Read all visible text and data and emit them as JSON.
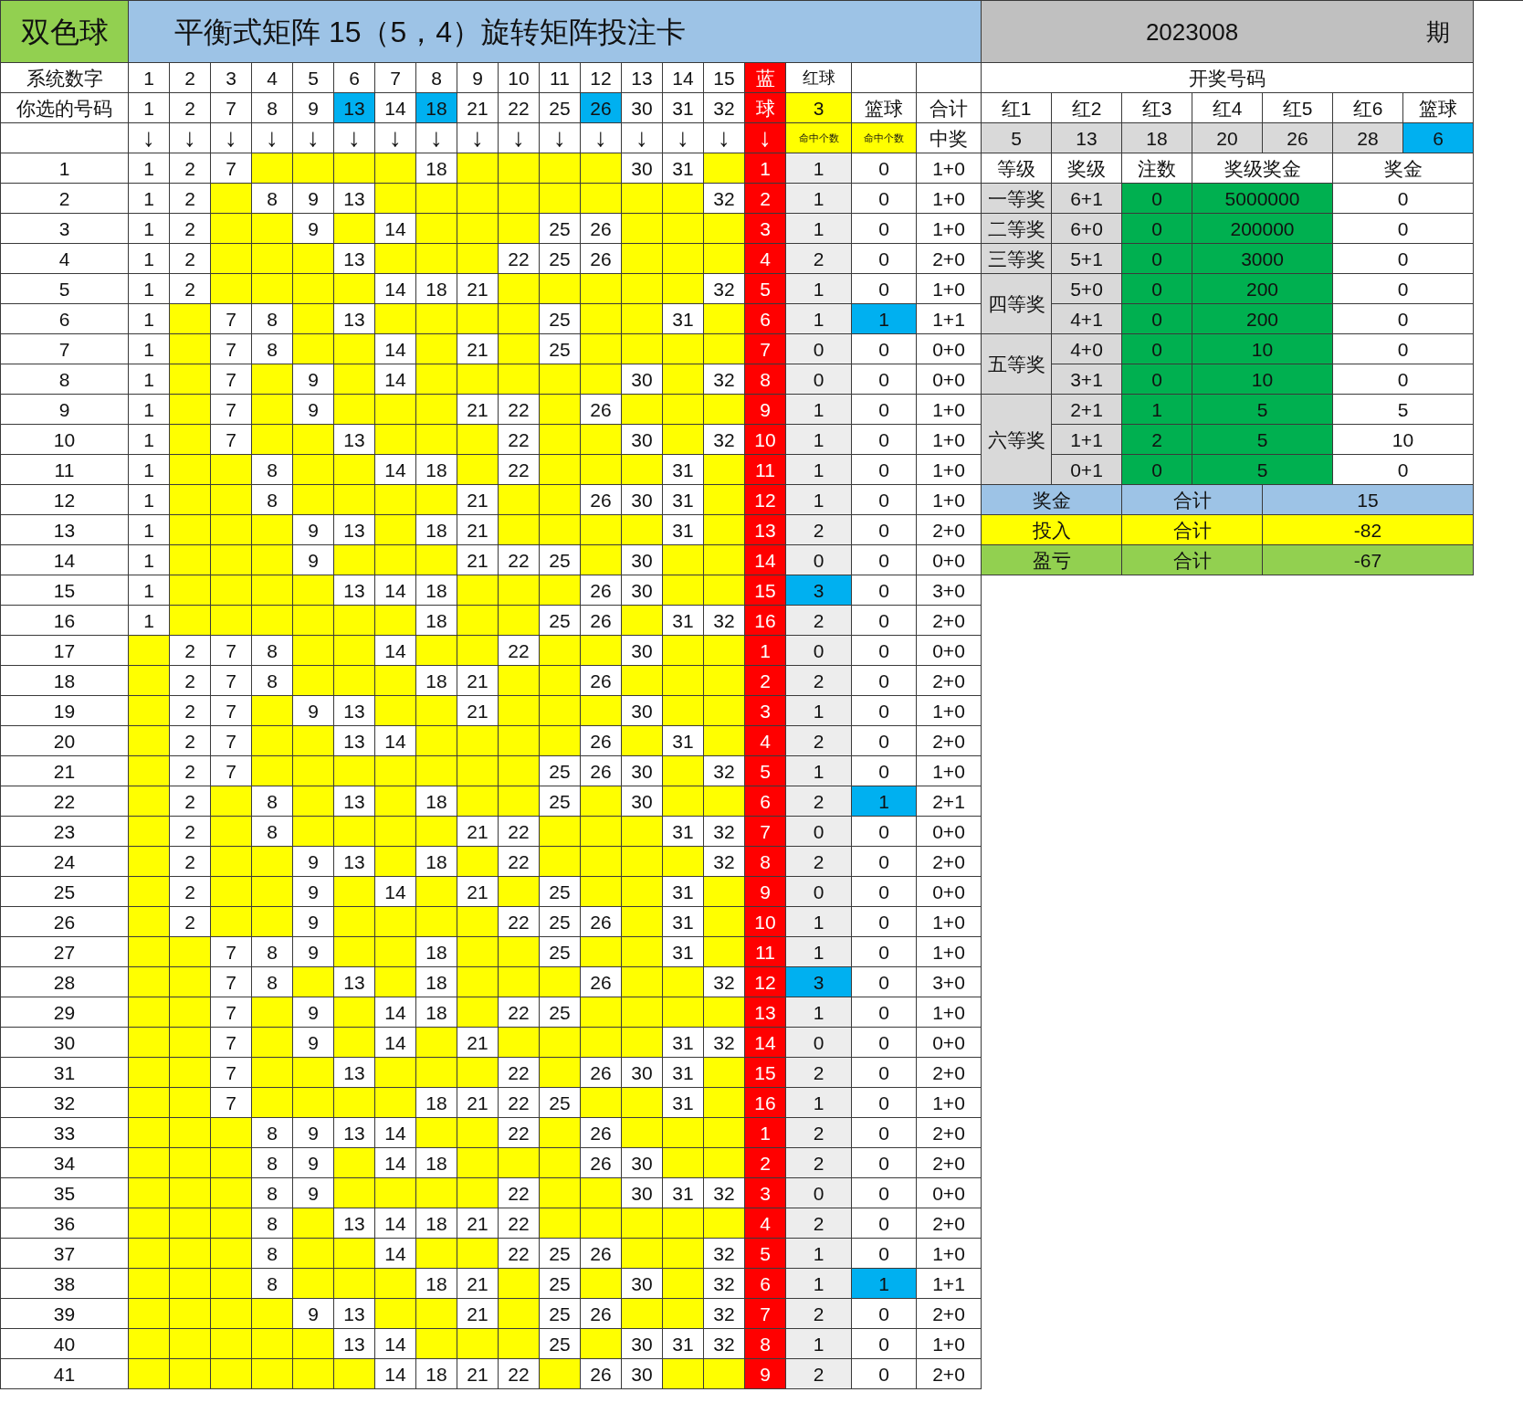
{
  "header": {
    "logo": "双色球",
    "title": "平衡式矩阵 15（5，4）旋转矩阵投注卡",
    "issue": "2023008",
    "issue_suffix": "期"
  },
  "system_row": {
    "label": "系统数字",
    "numbers": [
      "1",
      "2",
      "3",
      "4",
      "5",
      "6",
      "7",
      "8",
      "9",
      "10",
      "11",
      "12",
      "13",
      "14",
      "15"
    ],
    "blue_label": "蓝",
    "red_label": "红球"
  },
  "pick_row": {
    "label": "你选的号码",
    "numbers": [
      {
        "value": "1",
        "highlighted": false
      },
      {
        "value": "2",
        "highlighted": false
      },
      {
        "value": "7",
        "highlighted": false
      },
      {
        "value": "8",
        "highlighted": false
      },
      {
        "value": "9",
        "highlighted": false
      },
      {
        "value": "13",
        "highlighted": true
      },
      {
        "value": "14",
        "highlighted": false
      },
      {
        "value": "18",
        "highlighted": true
      },
      {
        "value": "21",
        "highlighted": false
      },
      {
        "value": "22",
        "highlighted": false
      },
      {
        "value": "25",
        "highlighted": false
      },
      {
        "value": "26",
        "highlighted": true
      },
      {
        "value": "30",
        "highlighted": false
      },
      {
        "value": "31",
        "highlighted": false
      },
      {
        "value": "32",
        "highlighted": false
      }
    ],
    "blue_label": "球",
    "red_hits": "3",
    "blue_ball_label": "篮球",
    "total_label": "合计"
  },
  "arrow_row": {
    "arrows": [
      "↓",
      "↓",
      "↓",
      "↓",
      "↓",
      "↓",
      "↓",
      "↓",
      "↓",
      "↓",
      "↓",
      "↓",
      "↓",
      "↓",
      "↓",
      "↓"
    ],
    "red_hits_label": "命中个数",
    "blue_hits_label": "命中个数",
    "prize_label": "中奖"
  },
  "rows": [
    {
      "no": "1",
      "cells": [
        "1",
        "2",
        "7",
        null,
        null,
        null,
        null,
        "18",
        null,
        null,
        null,
        null,
        "30",
        "31",
        null
      ],
      "blue": "1",
      "red_hits": "1",
      "blue_hits": "0",
      "total": "1+0",
      "red_hits_highlighted": false,
      "blue_hits_highlighted": false
    },
    {
      "no": "2",
      "cells": [
        "1",
        "2",
        null,
        "8",
        "9",
        "13",
        null,
        null,
        null,
        null,
        null,
        null,
        null,
        null,
        "32"
      ],
      "blue": "2",
      "red_hits": "1",
      "blue_hits": "0",
      "total": "1+0",
      "red_hits_highlighted": false,
      "blue_hits_highlighted": false
    },
    {
      "no": "3",
      "cells": [
        "1",
        "2",
        null,
        null,
        "9",
        null,
        "14",
        null,
        null,
        null,
        "25",
        "26",
        null,
        null,
        null
      ],
      "blue": "3",
      "red_hits": "1",
      "blue_hits": "0",
      "total": "1+0",
      "red_hits_highlighted": false,
      "blue_hits_highlighted": false
    },
    {
      "no": "4",
      "cells": [
        "1",
        "2",
        null,
        null,
        null,
        "13",
        null,
        null,
        null,
        "22",
        "25",
        "26",
        null,
        null,
        null
      ],
      "blue": "4",
      "red_hits": "2",
      "blue_hits": "0",
      "total": "2+0",
      "red_hits_highlighted": false,
      "blue_hits_highlighted": false
    },
    {
      "no": "5",
      "cells": [
        "1",
        "2",
        null,
        null,
        null,
        null,
        "14",
        "18",
        "21",
        null,
        null,
        null,
        null,
        null,
        "32"
      ],
      "blue": "5",
      "red_hits": "1",
      "blue_hits": "0",
      "total": "1+0",
      "red_hits_highlighted": false,
      "blue_hits_highlighted": false
    },
    {
      "no": "6",
      "cells": [
        "1",
        null,
        "7",
        "8",
        null,
        "13",
        null,
        null,
        null,
        null,
        "25",
        null,
        null,
        "31",
        null
      ],
      "blue": "6",
      "red_hits": "1",
      "blue_hits": "1",
      "total": "1+1",
      "red_hits_highlighted": false,
      "blue_hits_highlighted": true
    },
    {
      "no": "7",
      "cells": [
        "1",
        null,
        "7",
        "8",
        null,
        null,
        "14",
        null,
        "21",
        null,
        "25",
        null,
        null,
        null,
        null
      ],
      "blue": "7",
      "red_hits": "0",
      "blue_hits": "0",
      "total": "0+0",
      "red_hits_highlighted": false,
      "blue_hits_highlighted": false
    },
    {
      "no": "8",
      "cells": [
        "1",
        null,
        "7",
        null,
        "9",
        null,
        "14",
        null,
        null,
        null,
        null,
        null,
        "30",
        null,
        "32"
      ],
      "blue": "8",
      "red_hits": "0",
      "blue_hits": "0",
      "total": "0+0",
      "red_hits_highlighted": false,
      "blue_hits_highlighted": false
    },
    {
      "no": "9",
      "cells": [
        "1",
        null,
        "7",
        null,
        "9",
        null,
        null,
        null,
        "21",
        "22",
        null,
        "26",
        null,
        null,
        null
      ],
      "blue": "9",
      "red_hits": "1",
      "blue_hits": "0",
      "total": "1+0",
      "red_hits_highlighted": false,
      "blue_hits_highlighted": false
    },
    {
      "no": "10",
      "cells": [
        "1",
        null,
        "7",
        null,
        null,
        "13",
        null,
        null,
        null,
        "22",
        null,
        null,
        "30",
        null,
        "32"
      ],
      "blue": "10",
      "red_hits": "1",
      "blue_hits": "0",
      "total": "1+0",
      "red_hits_highlighted": false,
      "blue_hits_highlighted": false
    },
    {
      "no": "11",
      "cells": [
        "1",
        null,
        null,
        "8",
        null,
        null,
        "14",
        "18",
        null,
        "22",
        null,
        null,
        null,
        "31",
        null
      ],
      "blue": "11",
      "red_hits": "1",
      "blue_hits": "0",
      "total": "1+0",
      "red_hits_highlighted": false,
      "blue_hits_highlighted": false
    },
    {
      "no": "12",
      "cells": [
        "1",
        null,
        null,
        "8",
        null,
        null,
        null,
        null,
        "21",
        null,
        null,
        "26",
        "30",
        "31",
        null
      ],
      "blue": "12",
      "red_hits": "1",
      "blue_hits": "0",
      "total": "1+0",
      "red_hits_highlighted": false,
      "blue_hits_highlighted": false
    },
    {
      "no": "13",
      "cells": [
        "1",
        null,
        null,
        null,
        "9",
        "13",
        null,
        "18",
        "21",
        null,
        null,
        null,
        null,
        "31",
        null
      ],
      "blue": "13",
      "red_hits": "2",
      "blue_hits": "0",
      "total": "2+0",
      "red_hits_highlighted": false,
      "blue_hits_highlighted": false
    },
    {
      "no": "14",
      "cells": [
        "1",
        null,
        null,
        null,
        "9",
        null,
        null,
        null,
        "21",
        "22",
        "25",
        null,
        "30",
        null,
        null
      ],
      "blue": "14",
      "red_hits": "0",
      "blue_hits": "0",
      "total": "0+0",
      "red_hits_highlighted": false,
      "blue_hits_highlighted": false
    },
    {
      "no": "15",
      "cells": [
        "1",
        null,
        null,
        null,
        null,
        "13",
        "14",
        "18",
        null,
        null,
        null,
        "26",
        "30",
        null,
        null
      ],
      "blue": "15",
      "red_hits": "3",
      "blue_hits": "0",
      "total": "3+0",
      "red_hits_highlighted": true,
      "blue_hits_highlighted": false
    },
    {
      "no": "16",
      "cells": [
        "1",
        null,
        null,
        null,
        null,
        null,
        null,
        "18",
        null,
        null,
        "25",
        "26",
        null,
        "31",
        "32"
      ],
      "blue": "16",
      "red_hits": "2",
      "blue_hits": "0",
      "total": "2+0",
      "red_hits_highlighted": false,
      "blue_hits_highlighted": false
    },
    {
      "no": "17",
      "cells": [
        null,
        "2",
        "7",
        "8",
        null,
        null,
        "14",
        null,
        null,
        "22",
        null,
        null,
        "30",
        null,
        null
      ],
      "blue": "1",
      "red_hits": "0",
      "blue_hits": "0",
      "total": "0+0",
      "red_hits_highlighted": false,
      "blue_hits_highlighted": false
    },
    {
      "no": "18",
      "cells": [
        null,
        "2",
        "7",
        "8",
        null,
        null,
        null,
        "18",
        "21",
        null,
        null,
        "26",
        null,
        null,
        null
      ],
      "blue": "2",
      "red_hits": "2",
      "blue_hits": "0",
      "total": "2+0",
      "red_hits_highlighted": false,
      "blue_hits_highlighted": false
    },
    {
      "no": "19",
      "cells": [
        null,
        "2",
        "7",
        null,
        "9",
        "13",
        null,
        null,
        "21",
        null,
        null,
        null,
        "30",
        null,
        null
      ],
      "blue": "3",
      "red_hits": "1",
      "blue_hits": "0",
      "total": "1+0",
      "red_hits_highlighted": false,
      "blue_hits_highlighted": false
    },
    {
      "no": "20",
      "cells": [
        null,
        "2",
        "7",
        null,
        null,
        "13",
        "14",
        null,
        null,
        null,
        null,
        "26",
        null,
        "31",
        null
      ],
      "blue": "4",
      "red_hits": "2",
      "blue_hits": "0",
      "total": "2+0",
      "red_hits_highlighted": false,
      "blue_hits_highlighted": false
    },
    {
      "no": "21",
      "cells": [
        null,
        "2",
        "7",
        null,
        null,
        null,
        null,
        null,
        null,
        null,
        "25",
        "26",
        "30",
        null,
        "32"
      ],
      "blue": "5",
      "red_hits": "1",
      "blue_hits": "0",
      "total": "1+0",
      "red_hits_highlighted": false,
      "blue_hits_highlighted": false
    },
    {
      "no": "22",
      "cells": [
        null,
        "2",
        null,
        "8",
        null,
        "13",
        null,
        "18",
        null,
        null,
        "25",
        null,
        "30",
        null,
        null
      ],
      "blue": "6",
      "red_hits": "2",
      "blue_hits": "1",
      "total": "2+1",
      "red_hits_highlighted": false,
      "blue_hits_highlighted": true
    },
    {
      "no": "23",
      "cells": [
        null,
        "2",
        null,
        "8",
        null,
        null,
        null,
        null,
        "21",
        "22",
        null,
        null,
        null,
        "31",
        "32"
      ],
      "blue": "7",
      "red_hits": "0",
      "blue_hits": "0",
      "total": "0+0",
      "red_hits_highlighted": false,
      "blue_hits_highlighted": false
    },
    {
      "no": "24",
      "cells": [
        null,
        "2",
        null,
        null,
        "9",
        "13",
        null,
        "18",
        null,
        "22",
        null,
        null,
        null,
        null,
        "32"
      ],
      "blue": "8",
      "red_hits": "2",
      "blue_hits": "0",
      "total": "2+0",
      "red_hits_highlighted": false,
      "blue_hits_highlighted": false
    },
    {
      "no": "25",
      "cells": [
        null,
        "2",
        null,
        null,
        "9",
        null,
        "14",
        null,
        "21",
        null,
        "25",
        null,
        null,
        "31",
        null
      ],
      "blue": "9",
      "red_hits": "0",
      "blue_hits": "0",
      "total": "0+0",
      "red_hits_highlighted": false,
      "blue_hits_highlighted": false
    },
    {
      "no": "26",
      "cells": [
        null,
        "2",
        null,
        null,
        "9",
        null,
        null,
        null,
        null,
        "22",
        "25",
        "26",
        null,
        "31",
        null
      ],
      "blue": "10",
      "red_hits": "1",
      "blue_hits": "0",
      "total": "1+0",
      "red_hits_highlighted": false,
      "blue_hits_highlighted": false
    },
    {
      "no": "27",
      "cells": [
        null,
        null,
        "7",
        "8",
        "9",
        null,
        null,
        "18",
        null,
        null,
        "25",
        null,
        null,
        "31",
        null
      ],
      "blue": "11",
      "red_hits": "1",
      "blue_hits": "0",
      "total": "1+0",
      "red_hits_highlighted": false,
      "blue_hits_highlighted": false
    },
    {
      "no": "28",
      "cells": [
        null,
        null,
        "7",
        "8",
        null,
        "13",
        null,
        "18",
        null,
        null,
        null,
        "26",
        null,
        null,
        "32"
      ],
      "blue": "12",
      "red_hits": "3",
      "blue_hits": "0",
      "total": "3+0",
      "red_hits_highlighted": true,
      "blue_hits_highlighted": false
    },
    {
      "no": "29",
      "cells": [
        null,
        null,
        "7",
        null,
        "9",
        null,
        "14",
        "18",
        null,
        "22",
        "25",
        null,
        null,
        null,
        null
      ],
      "blue": "13",
      "red_hits": "1",
      "blue_hits": "0",
      "total": "1+0",
      "red_hits_highlighted": false,
      "blue_hits_highlighted": false
    },
    {
      "no": "30",
      "cells": [
        null,
        null,
        "7",
        null,
        "9",
        null,
        "14",
        null,
        "21",
        null,
        null,
        null,
        null,
        "31",
        "32"
      ],
      "blue": "14",
      "red_hits": "0",
      "blue_hits": "0",
      "total": "0+0",
      "red_hits_highlighted": false,
      "blue_hits_highlighted": false
    },
    {
      "no": "31",
      "cells": [
        null,
        null,
        "7",
        null,
        null,
        "13",
        null,
        null,
        null,
        "22",
        null,
        "26",
        "30",
        "31",
        null
      ],
      "blue": "15",
      "red_hits": "2",
      "blue_hits": "0",
      "total": "2+0",
      "red_hits_highlighted": false,
      "blue_hits_highlighted": false
    },
    {
      "no": "32",
      "cells": [
        null,
        null,
        "7",
        null,
        null,
        null,
        null,
        "18",
        "21",
        "22",
        "25",
        null,
        null,
        "31",
        null
      ],
      "blue": "16",
      "red_hits": "1",
      "blue_hits": "0",
      "total": "1+0",
      "red_hits_highlighted": false,
      "blue_hits_highlighted": false
    },
    {
      "no": "33",
      "cells": [
        null,
        null,
        null,
        "8",
        "9",
        "13",
        "14",
        null,
        null,
        "22",
        null,
        "26",
        null,
        null,
        null
      ],
      "blue": "1",
      "red_hits": "2",
      "blue_hits": "0",
      "total": "2+0",
      "red_hits_highlighted": false,
      "blue_hits_highlighted": false
    },
    {
      "no": "34",
      "cells": [
        null,
        null,
        null,
        "8",
        "9",
        null,
        "14",
        "18",
        null,
        null,
        null,
        "26",
        "30",
        null,
        null
      ],
      "blue": "2",
      "red_hits": "2",
      "blue_hits": "0",
      "total": "2+0",
      "red_hits_highlighted": false,
      "blue_hits_highlighted": false
    },
    {
      "no": "35",
      "cells": [
        null,
        null,
        null,
        "8",
        "9",
        null,
        null,
        null,
        null,
        "22",
        null,
        null,
        "30",
        "31",
        "32"
      ],
      "blue": "3",
      "red_hits": "0",
      "blue_hits": "0",
      "total": "0+0",
      "red_hits_highlighted": false,
      "blue_hits_highlighted": false
    },
    {
      "no": "36",
      "cells": [
        null,
        null,
        null,
        "8",
        null,
        "13",
        "14",
        "18",
        "21",
        "22",
        null,
        null,
        null,
        null,
        null
      ],
      "blue": "4",
      "red_hits": "2",
      "blue_hits": "0",
      "total": "2+0",
      "red_hits_highlighted": false,
      "blue_hits_highlighted": false
    },
    {
      "no": "37",
      "cells": [
        null,
        null,
        null,
        "8",
        null,
        null,
        "14",
        null,
        null,
        "22",
        "25",
        "26",
        null,
        null,
        "32"
      ],
      "blue": "5",
      "red_hits": "1",
      "blue_hits": "0",
      "total": "1+0",
      "red_hits_highlighted": false,
      "blue_hits_highlighted": false
    },
    {
      "no": "38",
      "cells": [
        null,
        null,
        null,
        "8",
        null,
        null,
        null,
        "18",
        "21",
        null,
        "25",
        null,
        "30",
        null,
        "32"
      ],
      "blue": "6",
      "red_hits": "1",
      "blue_hits": "1",
      "total": "1+1",
      "red_hits_highlighted": false,
      "blue_hits_highlighted": true
    },
    {
      "no": "39",
      "cells": [
        null,
        null,
        null,
        null,
        "9",
        "13",
        null,
        null,
        "21",
        null,
        "25",
        "26",
        null,
        null,
        "32"
      ],
      "blue": "7",
      "red_hits": "2",
      "blue_hits": "0",
      "total": "2+0",
      "red_hits_highlighted": false,
      "blue_hits_highlighted": false
    },
    {
      "no": "40",
      "cells": [
        null,
        null,
        null,
        null,
        null,
        "13",
        "14",
        null,
        null,
        null,
        "25",
        null,
        "30",
        "31",
        "32"
      ],
      "blue": "8",
      "red_hits": "1",
      "blue_hits": "0",
      "total": "1+0",
      "red_hits_highlighted": false,
      "blue_hits_highlighted": false
    },
    {
      "no": "41",
      "cells": [
        null,
        null,
        null,
        null,
        null,
        null,
        "14",
        "18",
        "21",
        "22",
        null,
        "26",
        "30",
        null,
        null
      ],
      "blue": "9",
      "red_hits": "2",
      "blue_hits": "0",
      "total": "2+0",
      "red_hits_highlighted": false,
      "blue_hits_highlighted": false
    }
  ],
  "draw": {
    "title": "开奖号码",
    "columns": [
      "红1",
      "红2",
      "红3",
      "红4",
      "红5",
      "红6",
      "篮球"
    ],
    "numbers": [
      {
        "value": "5",
        "kind": "red"
      },
      {
        "value": "13",
        "kind": "red"
      },
      {
        "value": "18",
        "kind": "red"
      },
      {
        "value": "20",
        "kind": "red"
      },
      {
        "value": "26",
        "kind": "red"
      },
      {
        "value": "28",
        "kind": "red"
      },
      {
        "value": "6",
        "kind": "blue"
      }
    ]
  },
  "prize_table": {
    "columns": [
      "等级",
      "奖级",
      "注数",
      "奖级奖金",
      "奖金"
    ],
    "groups": [
      {
        "level": "一等奖",
        "rows": [
          {
            "pattern": "6+1",
            "count": "0",
            "amount": "5000000",
            "prize": "0"
          }
        ]
      },
      {
        "level": "二等奖",
        "rows": [
          {
            "pattern": "6+0",
            "count": "0",
            "amount": "200000",
            "prize": "0"
          }
        ]
      },
      {
        "level": "三等奖",
        "rows": [
          {
            "pattern": "5+1",
            "count": "0",
            "amount": "3000",
            "prize": "0"
          }
        ]
      },
      {
        "level": "四等奖",
        "rows": [
          {
            "pattern": "5+0",
            "count": "0",
            "amount": "200",
            "prize": "0"
          },
          {
            "pattern": "4+1",
            "count": "0",
            "amount": "200",
            "prize": "0"
          }
        ]
      },
      {
        "level": "五等奖",
        "rows": [
          {
            "pattern": "4+0",
            "count": "0",
            "amount": "10",
            "prize": "0"
          },
          {
            "pattern": "3+1",
            "count": "0",
            "amount": "10",
            "prize": "0"
          }
        ]
      },
      {
        "level": "六等奖",
        "rows": [
          {
            "pattern": "2+1",
            "count": "1",
            "amount": "5",
            "prize": "5"
          },
          {
            "pattern": "1+1",
            "count": "2",
            "amount": "5",
            "prize": "10"
          },
          {
            "pattern": "0+1",
            "count": "0",
            "amount": "5",
            "prize": "0"
          }
        ]
      }
    ]
  },
  "summary": [
    {
      "label": "奖金",
      "sub": "合计",
      "value": "15",
      "kind": "prize"
    },
    {
      "label": "投入",
      "sub": "合计",
      "value": "-82",
      "kind": "cost"
    },
    {
      "label": "盈亏",
      "sub": "合计",
      "value": "-67",
      "kind": "profit"
    }
  ]
}
